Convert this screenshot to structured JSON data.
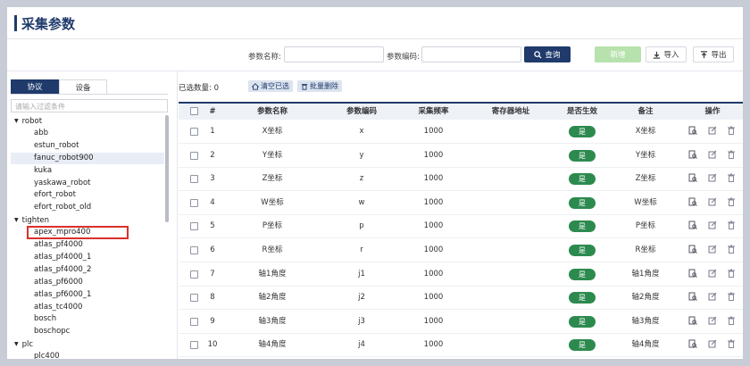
{
  "page": {
    "title": "采集参数"
  },
  "search": {
    "name_label": "参数名称:",
    "code_label": "参数编码:",
    "query_label": "查询",
    "add_label": "新增",
    "import_label": "导入",
    "export_label": "导出"
  },
  "left": {
    "tabs": [
      "协议",
      "设备"
    ],
    "filter_placeholder": "请输入过滤条件",
    "tree": [
      {
        "type": "group",
        "label": "robot"
      },
      {
        "type": "leaf",
        "label": "abb"
      },
      {
        "type": "leaf",
        "label": "estun_robot"
      },
      {
        "type": "leaf",
        "label": "fanuc_robot900",
        "selected": true
      },
      {
        "type": "leaf",
        "label": "kuka"
      },
      {
        "type": "leaf",
        "label": "yaskawa_robot"
      },
      {
        "type": "leaf",
        "label": "efort_robot"
      },
      {
        "type": "leaf",
        "label": "efort_robot_old"
      },
      {
        "type": "group",
        "label": "tighten"
      },
      {
        "type": "leaf",
        "label": "apex_mpro400",
        "highlighted": true
      },
      {
        "type": "leaf",
        "label": "atlas_pf4000"
      },
      {
        "type": "leaf",
        "label": "atlas_pf4000_1"
      },
      {
        "type": "leaf",
        "label": "atlas_pf4000_2"
      },
      {
        "type": "leaf",
        "label": "atlas_pf6000"
      },
      {
        "type": "leaf",
        "label": "atlas_pf6000_1"
      },
      {
        "type": "leaf",
        "label": "atlas_tc4000"
      },
      {
        "type": "leaf",
        "label": "bosch"
      },
      {
        "type": "leaf",
        "label": "boschopc"
      },
      {
        "type": "group",
        "label": "plc"
      },
      {
        "type": "leaf",
        "label": "plc400"
      }
    ]
  },
  "table": {
    "selected_label": "已选数量: 0",
    "clear_label": "清空已选",
    "batch_delete_label": "批量删除",
    "columns": [
      "#",
      "参数名称",
      "参数编码",
      "采集频率",
      "寄存器地址",
      "是否生效",
      "备注",
      "操作"
    ],
    "rows": [
      {
        "no": "1",
        "name": "X坐标",
        "code": "x",
        "freq": "1000",
        "reg": "",
        "active": "是",
        "note": "X坐标"
      },
      {
        "no": "2",
        "name": "Y坐标",
        "code": "y",
        "freq": "1000",
        "reg": "",
        "active": "是",
        "note": "Y坐标"
      },
      {
        "no": "3",
        "name": "Z坐标",
        "code": "z",
        "freq": "1000",
        "reg": "",
        "active": "是",
        "note": "Z坐标"
      },
      {
        "no": "4",
        "name": "W坐标",
        "code": "w",
        "freq": "1000",
        "reg": "",
        "active": "是",
        "note": "W坐标"
      },
      {
        "no": "5",
        "name": "P坐标",
        "code": "p",
        "freq": "1000",
        "reg": "",
        "active": "是",
        "note": "P坐标"
      },
      {
        "no": "6",
        "name": "R坐标",
        "code": "r",
        "freq": "1000",
        "reg": "",
        "active": "是",
        "note": "R坐标"
      },
      {
        "no": "7",
        "name": "轴1角度",
        "code": "j1",
        "freq": "1000",
        "reg": "",
        "active": "是",
        "note": "轴1角度"
      },
      {
        "no": "8",
        "name": "轴2角度",
        "code": "j2",
        "freq": "1000",
        "reg": "",
        "active": "是",
        "note": "轴2角度"
      },
      {
        "no": "9",
        "name": "轴3角度",
        "code": "j3",
        "freq": "1000",
        "reg": "",
        "active": "是",
        "note": "轴3角度"
      },
      {
        "no": "10",
        "name": "轴4角度",
        "code": "j4",
        "freq": "1000",
        "reg": "",
        "active": "是",
        "note": "轴4角度"
      }
    ]
  },
  "colors": {
    "primary": "#1f3a6b",
    "active_pill": "#2d8a4f",
    "add_button": "#b7e2ad",
    "highlight_box": "#d9312b"
  },
  "icons": {
    "query": "search-icon",
    "import": "download-icon",
    "export": "upload-icon",
    "clear": "home-icon",
    "batch_delete": "trash-icon",
    "ops": [
      "view-icon",
      "edit-icon",
      "delete-icon"
    ]
  }
}
